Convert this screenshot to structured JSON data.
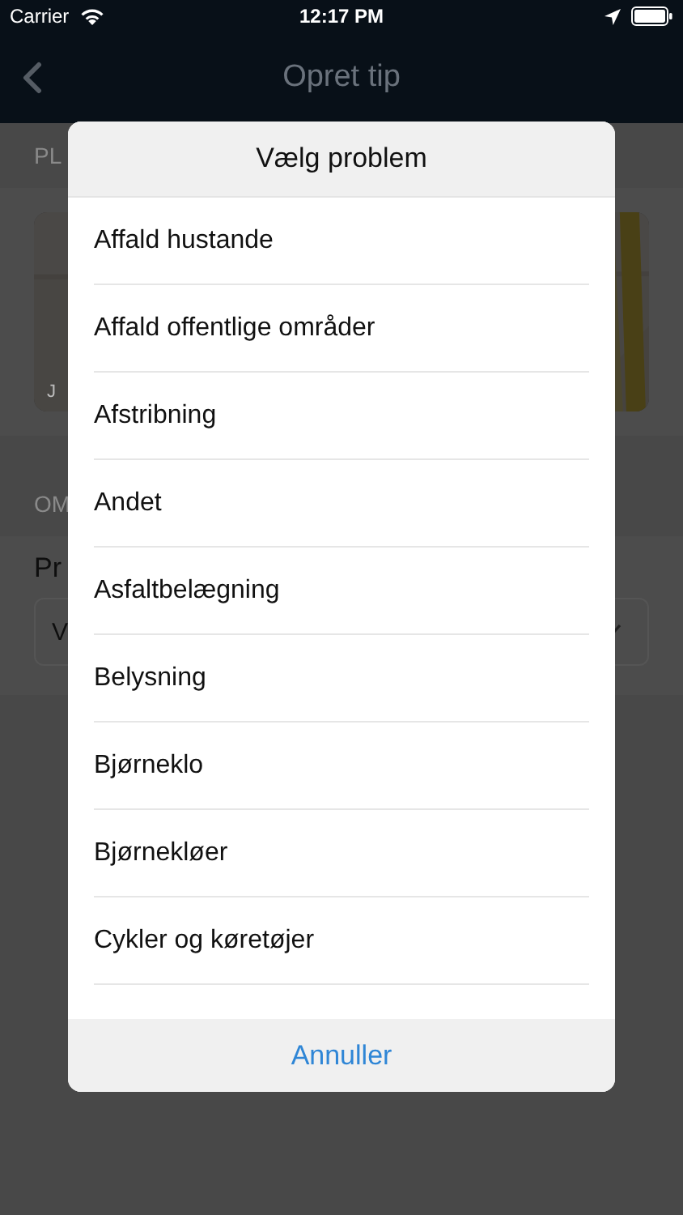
{
  "status_bar": {
    "carrier": "Carrier",
    "time": "12:17 PM"
  },
  "nav_bar": {
    "title": "Opret tip"
  },
  "background": {
    "place_header": "PL",
    "map_label": "J",
    "about_header": "OM",
    "problem_label": "Pr",
    "problem_value": "V"
  },
  "dialog": {
    "title": "Vælg problem",
    "items": [
      {
        "label": "Affald hustande"
      },
      {
        "label": "Affald offentlige områder"
      },
      {
        "label": "Afstribning"
      },
      {
        "label": "Andet"
      },
      {
        "label": "Asfaltbelægning"
      },
      {
        "label": "Belysning"
      },
      {
        "label": "Bjørneklo"
      },
      {
        "label": "Bjørnekløer"
      },
      {
        "label": "Cykler og køretøjer"
      }
    ],
    "cancel": "Annuller"
  }
}
